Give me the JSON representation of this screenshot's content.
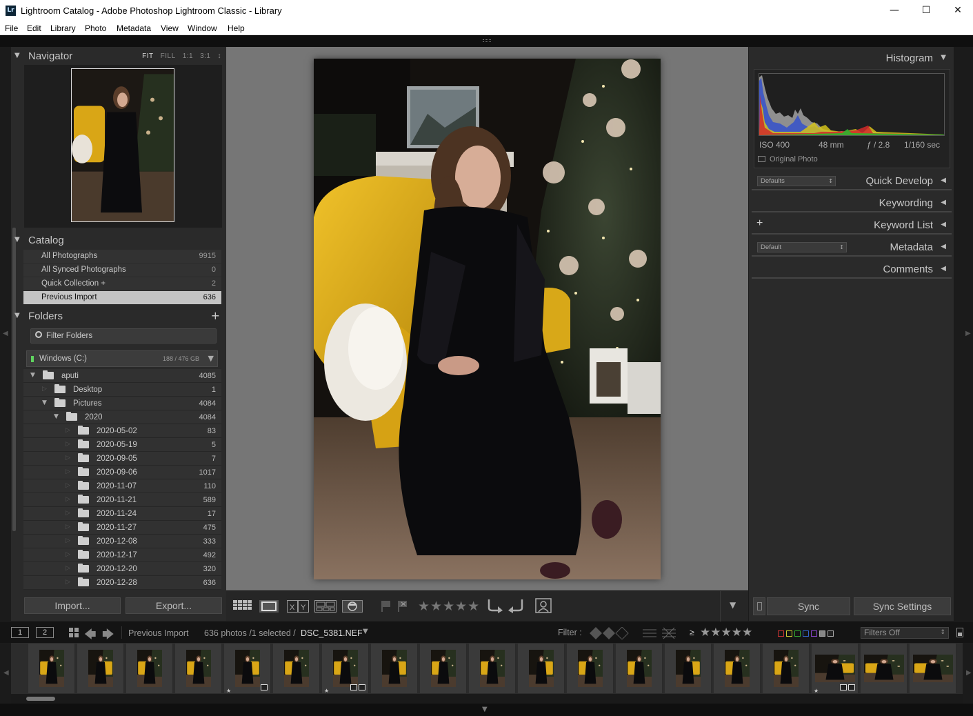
{
  "window": {
    "app_icon": "Lr",
    "title": "Lightroom Catalog - Adobe Photoshop Lightroom Classic - Library",
    "minimize_icon": "minimize-icon",
    "maximize_icon": "maximize-icon",
    "close_icon": "close-icon"
  },
  "menu": [
    "File",
    "Edit",
    "Library",
    "Photo",
    "Metadata",
    "View",
    "Window",
    "Help"
  ],
  "navigator": {
    "title": "Navigator",
    "modes": [
      "FIT",
      "FILL",
      "1:1",
      "3:1"
    ],
    "active_mode": "FIT"
  },
  "catalog": {
    "title": "Catalog",
    "items": [
      {
        "label": "All Photographs",
        "count": "9915"
      },
      {
        "label": "All Synced Photographs",
        "count": "0"
      },
      {
        "label": "Quick Collection +",
        "count": "2"
      },
      {
        "label": "Previous Import",
        "count": "636"
      }
    ],
    "selected": "Previous Import"
  },
  "folders": {
    "title": "Folders",
    "add_icon": "plus-icon",
    "filter_placeholder": "Filter Folders",
    "volume": {
      "name": "Windows (C:)",
      "size": "188 / 476 GB"
    },
    "items": [
      {
        "name": "aputi",
        "count": "4085",
        "depth": 0,
        "expanded": true
      },
      {
        "name": "Desktop",
        "count": "1",
        "depth": 1,
        "expanded": false
      },
      {
        "name": "Pictures",
        "count": "4084",
        "depth": 1,
        "expanded": true
      },
      {
        "name": "2020",
        "count": "4084",
        "depth": 2,
        "expanded": true
      },
      {
        "name": "2020-05-02",
        "count": "83",
        "depth": 3,
        "expanded": false
      },
      {
        "name": "2020-05-19",
        "count": "5",
        "depth": 3,
        "expanded": false
      },
      {
        "name": "2020-09-05",
        "count": "7",
        "depth": 3,
        "expanded": false
      },
      {
        "name": "2020-09-06",
        "count": "1017",
        "depth": 3,
        "expanded": false
      },
      {
        "name": "2020-11-07",
        "count": "110",
        "depth": 3,
        "expanded": false
      },
      {
        "name": "2020-11-21",
        "count": "589",
        "depth": 3,
        "expanded": false
      },
      {
        "name": "2020-11-24",
        "count": "17",
        "depth": 3,
        "expanded": false
      },
      {
        "name": "2020-11-27",
        "count": "475",
        "depth": 3,
        "expanded": false
      },
      {
        "name": "2020-12-08",
        "count": "333",
        "depth": 3,
        "expanded": false
      },
      {
        "name": "2020-12-17",
        "count": "492",
        "depth": 3,
        "expanded": false
      },
      {
        "name": "2020-12-20",
        "count": "320",
        "depth": 3,
        "expanded": false
      },
      {
        "name": "2020-12-28",
        "count": "636",
        "depth": 3,
        "expanded": false
      }
    ]
  },
  "left_buttons": {
    "import": "Import...",
    "export": "Export..."
  },
  "toolbar": {
    "icons": [
      "grid-view-icon",
      "loupe-view-icon",
      "compare-view-icon",
      "survey-view-icon",
      "people-view-icon",
      "flag-icon",
      "reject-flag-icon",
      "star-rating-icon",
      "rotate-left-icon",
      "rotate-right-icon",
      "crop-overlay-icon",
      "toolbar-menu-icon"
    ],
    "stars": "★★★★★"
  },
  "histogram": {
    "title": "Histogram",
    "iso": "ISO 400",
    "focal": "48 mm",
    "aperture": "ƒ / 2.8",
    "shutter": "1/160 sec",
    "original_photo": "Original Photo"
  },
  "right_panels": [
    {
      "label": "Quick Develop",
      "select": "Defaults"
    },
    {
      "label": "Keywording"
    },
    {
      "label": "Keyword List",
      "prefix": "+"
    },
    {
      "label": "Metadata",
      "select": "Default"
    },
    {
      "label": "Comments"
    }
  ],
  "right_buttons": {
    "sync": "Sync",
    "sync_settings": "Sync Settings"
  },
  "filmstrip_bar": {
    "monitor1": "1",
    "monitor2": "2",
    "source": "Previous Import",
    "count_text": "636 photos /1 selected /",
    "filename": "DSC_5381.NEF",
    "filter_label": "Filter :",
    "rating_op": "≥",
    "stars": "★★★★★",
    "filters_select": "Filters Off"
  },
  "filmstrip": {
    "thumbnails": 19,
    "starred": [
      4,
      6,
      16
    ],
    "badged": [
      4,
      6,
      16
    ]
  },
  "colors": {
    "panel_bg": "#2a2a2a",
    "center_bg": "#767676",
    "selected_row": "#c4c4c4",
    "chair_yellow": "#e0b21a"
  }
}
